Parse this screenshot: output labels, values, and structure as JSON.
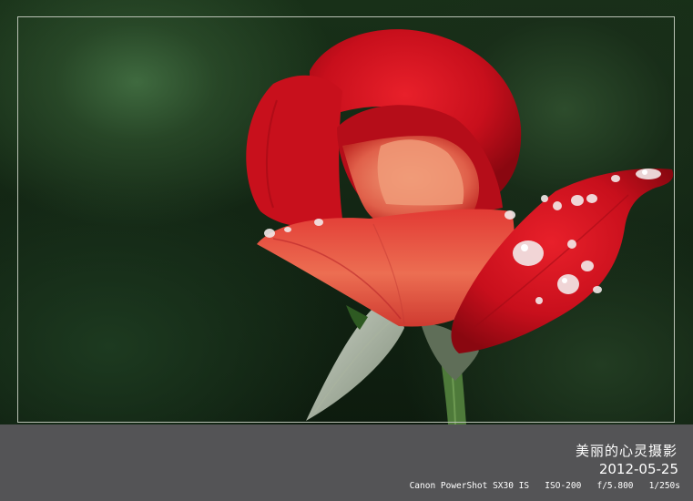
{
  "photo": {
    "subject": "rose-icon",
    "accent_color": "#d01520",
    "background_color": "#183018"
  },
  "caption": {
    "title": "美丽的心灵摄影",
    "date": "2012-05-25",
    "exif": "Canon PowerShot SX30 IS   ISO-200   f/5.800   1/250s"
  }
}
